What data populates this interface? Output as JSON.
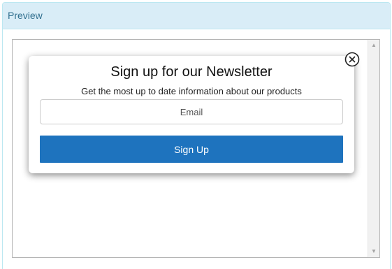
{
  "panel": {
    "heading": "Preview"
  },
  "scrollbar": {
    "up_arrow": "▲",
    "down_arrow": "▼"
  },
  "popup": {
    "title": "Sign up for our Newsletter",
    "subtitle": "Get the most up to date information about our products",
    "email_placeholder": "Email",
    "email_value": "",
    "button_label": "Sign Up",
    "close_icon": "close-circle-icon"
  },
  "colors": {
    "panel_heading_bg": "#d9edf7",
    "panel_heading_text": "#31708f",
    "button_bg": "#1e73be"
  }
}
